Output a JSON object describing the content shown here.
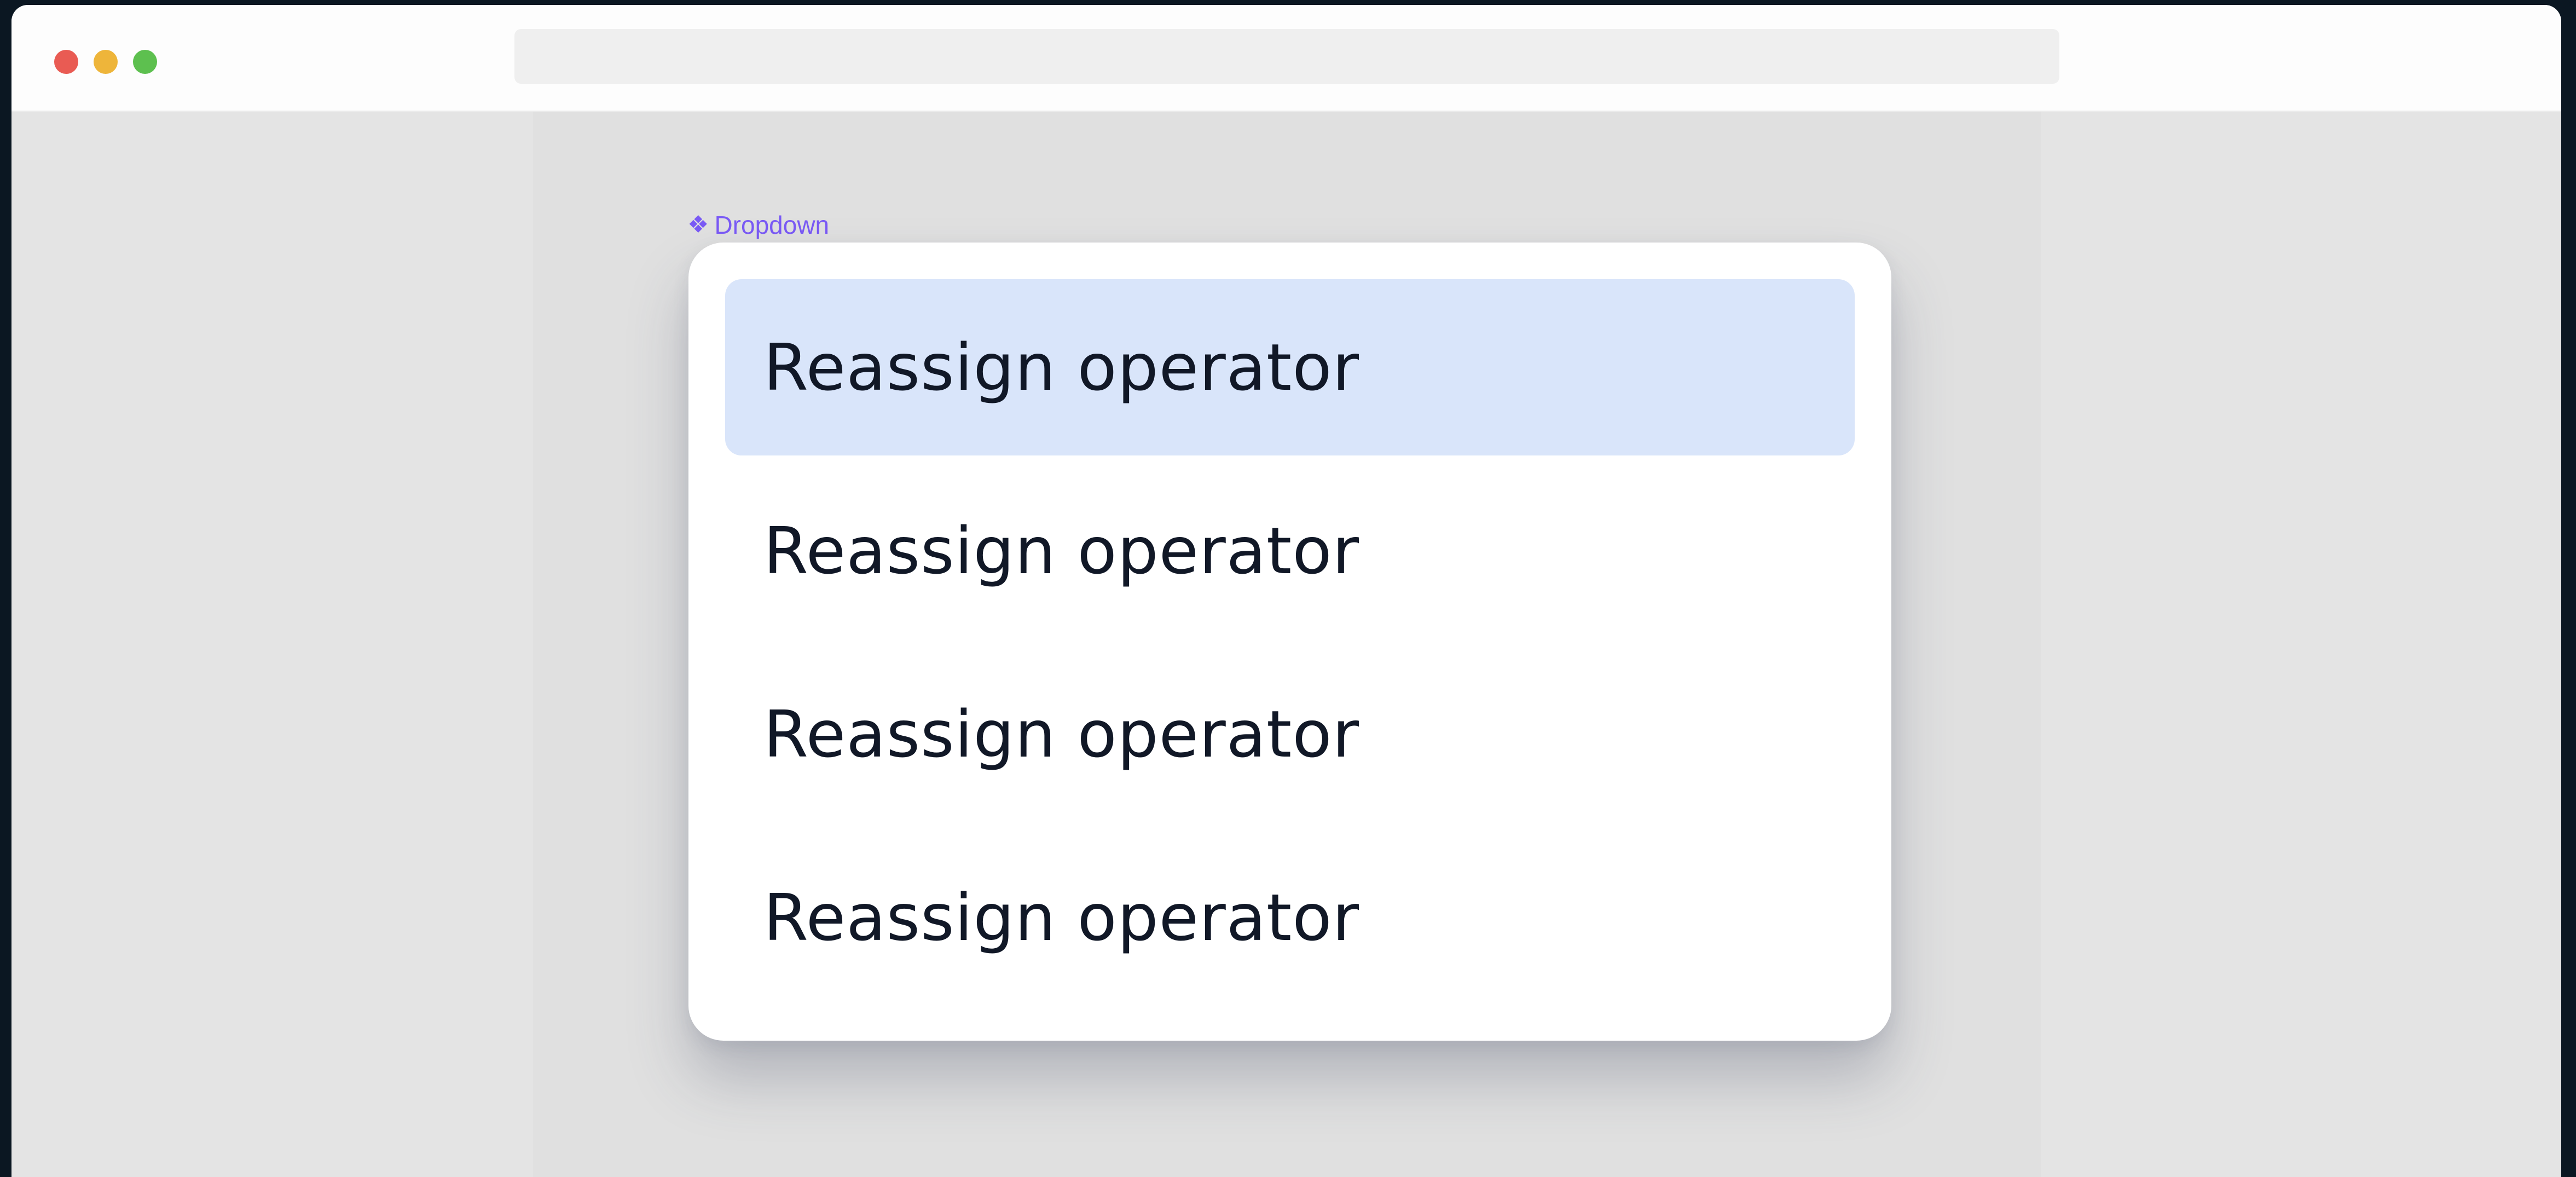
{
  "window": {
    "controls": [
      "close",
      "minimize",
      "maximize"
    ],
    "colors": {
      "close": "#e95b53",
      "minimize": "#eeb53a",
      "maximize": "#5dc04f"
    }
  },
  "canvas": {
    "component_label": {
      "icon": "component-diamond-icon",
      "text": "Dropdown",
      "color": "#7a5af5"
    }
  },
  "dropdown": {
    "selected_index": 0,
    "highlight_color": "#d9e5fa",
    "items": [
      {
        "label": "Reassign operator"
      },
      {
        "label": "Reassign operator"
      },
      {
        "label": "Reassign operator"
      },
      {
        "label": "Reassign operator"
      }
    ]
  }
}
